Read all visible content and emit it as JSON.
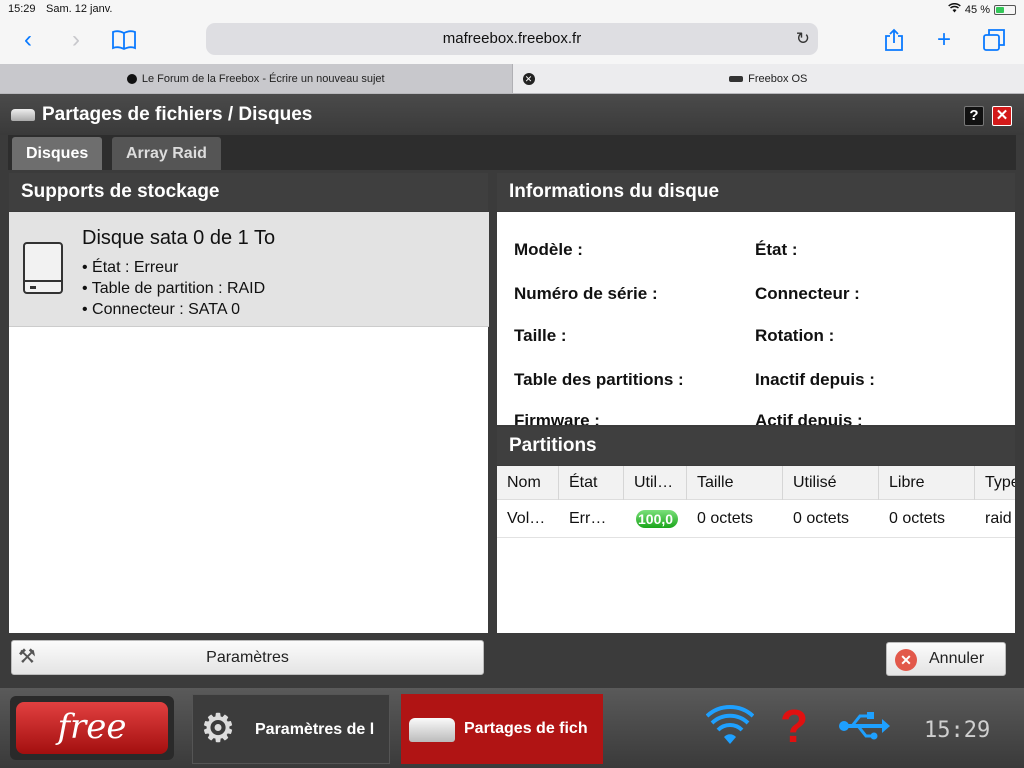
{
  "status_bar": {
    "time": "15:29",
    "date": "Sam. 12 janv.",
    "battery": "45 %",
    "battery_level": 0.45
  },
  "browser": {
    "url": "mafreebox.freebox.fr",
    "tabs": [
      {
        "label": "Le Forum de la Freebox - Écrire un nouveau sujet"
      },
      {
        "label": "Freebox OS"
      }
    ]
  },
  "window": {
    "title": "Partages de fichiers / Disques",
    "help_label": "?",
    "close_label": "✕",
    "tabs": [
      {
        "label": "Disques"
      },
      {
        "label": "Array Raid"
      }
    ]
  },
  "storage": {
    "header": "Supports de stockage",
    "disk": {
      "title": "Disque sata 0 de 1 To",
      "lines": [
        "• État : Erreur",
        "• Table de partition : RAID",
        "• Connecteur : SATA 0"
      ]
    }
  },
  "disk_info": {
    "header": "Informations du disque",
    "labels_left": [
      "Modèle :",
      "Numéro de série :",
      "Taille :",
      "Table des partitions :",
      "Firmware :"
    ],
    "labels_right": [
      "État :",
      "Connecteur :",
      "Rotation :",
      "Inactif depuis :",
      "Actif depuis :"
    ]
  },
  "partitions": {
    "header": "Partitions",
    "columns": [
      "Nom",
      "État",
      "Util…",
      "Taille",
      "Utilisé",
      "Libre",
      "Type"
    ],
    "rows": [
      {
        "name": "Vol…",
        "state": "Err…",
        "usage": "100,0",
        "usage_fraction": 1.0,
        "size": "0 octets",
        "used": "0 octets",
        "free": "0 octets",
        "type": "raid"
      }
    ]
  },
  "buttons": {
    "params": "Paramètres",
    "cancel": "Annuler"
  },
  "taskbar": {
    "logo": "free",
    "items": [
      {
        "label": "Paramètres de l"
      },
      {
        "label": "Partages de fich"
      }
    ],
    "clock": "15:29",
    "icons": [
      "wifi-icon",
      "help-icon",
      "usb-icon"
    ]
  },
  "colors": {
    "accent_blue": "#0a7aff",
    "freebox_red": "#b01414",
    "usage_green": "#1aa51a"
  }
}
